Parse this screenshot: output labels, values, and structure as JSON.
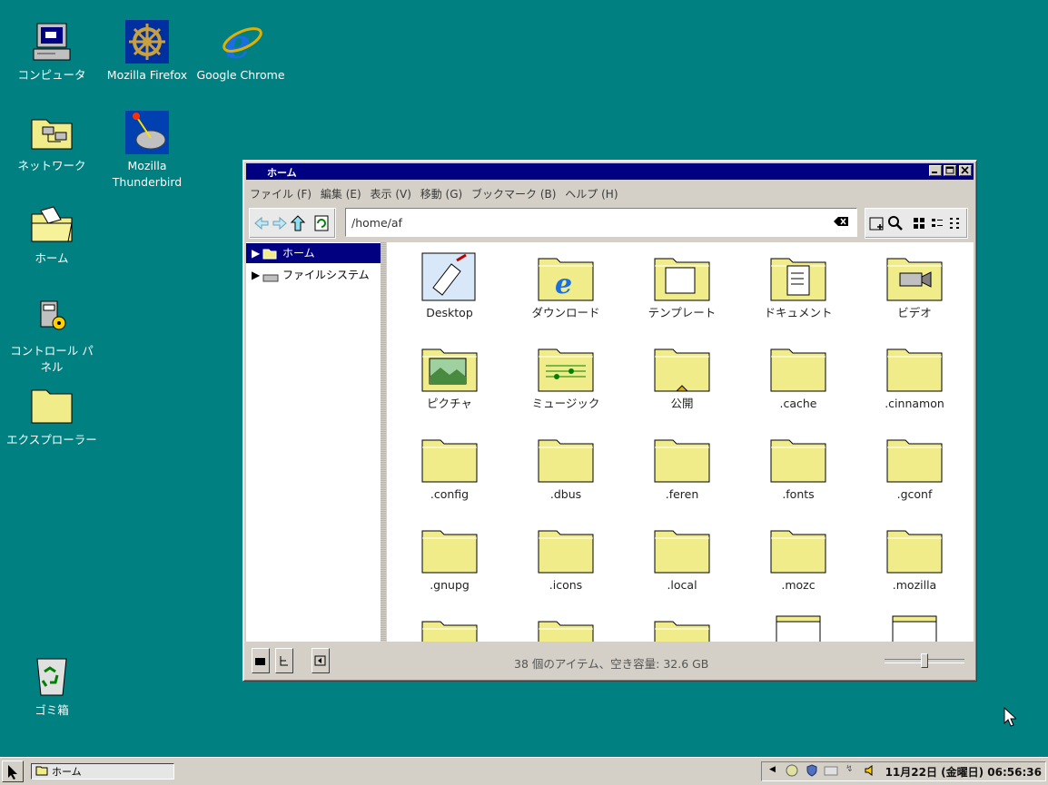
{
  "desktop": {
    "icons": [
      {
        "label": "コンピュータ",
        "icon": "computer-icon"
      },
      {
        "label": "Mozilla Firefox",
        "icon": "firefox-icon"
      },
      {
        "label": "Google Chrome",
        "icon": "chrome-icon"
      },
      {
        "label": "ネットワーク",
        "icon": "network-icon"
      },
      {
        "label": "Mozilla\nThunderbird",
        "icon": "thunderbird-icon"
      },
      {
        "label": "ホーム",
        "icon": "home-folder-icon"
      },
      {
        "label": "コントロール パネル",
        "icon": "control-panel-icon"
      },
      {
        "label": "エクスプローラー",
        "icon": "folder-icon"
      },
      {
        "label": "ゴミ箱",
        "icon": "trash-icon"
      }
    ]
  },
  "window": {
    "title": "ホーム",
    "menu": [
      "ファイル (F)",
      "編集 (E)",
      "表示 (V)",
      "移動 (G)",
      "ブックマーク (B)",
      "ヘルプ (H)"
    ],
    "address": "/home/af",
    "sidebar": [
      {
        "label": "ホーム",
        "icon": "home-icon",
        "selected": true
      },
      {
        "label": "ファイルシステム",
        "icon": "drive-icon",
        "selected": false
      }
    ],
    "files": [
      {
        "name": "Desktop",
        "icon": "desktop-icon"
      },
      {
        "name": "ダウンロード",
        "icon": "downloads-folder-icon"
      },
      {
        "name": "テンプレート",
        "icon": "templates-folder-icon"
      },
      {
        "name": "ドキュメント",
        "icon": "documents-folder-icon"
      },
      {
        "name": "ビデオ",
        "icon": "videos-folder-icon"
      },
      {
        "name": "ピクチャ",
        "icon": "pictures-folder-icon"
      },
      {
        "name": "ミュージック",
        "icon": "music-folder-icon"
      },
      {
        "name": "公開",
        "icon": "public-folder-icon"
      },
      {
        "name": ".cache",
        "icon": "folder-icon"
      },
      {
        "name": ".cinnamon",
        "icon": "folder-icon"
      },
      {
        "name": ".config",
        "icon": "folder-icon"
      },
      {
        "name": ".dbus",
        "icon": "folder-icon"
      },
      {
        "name": ".feren",
        "icon": "folder-icon"
      },
      {
        "name": ".fonts",
        "icon": "folder-icon"
      },
      {
        "name": ".gconf",
        "icon": "folder-icon"
      },
      {
        "name": ".gnupg",
        "icon": "folder-icon"
      },
      {
        "name": ".icons",
        "icon": "folder-icon"
      },
      {
        "name": ".local",
        "icon": "folder-icon"
      },
      {
        "name": ".mozc",
        "icon": "folder-icon"
      },
      {
        "name": ".mozilla",
        "icon": "folder-icon"
      }
    ],
    "status": "38 個のアイテム、空き容量: 32.6 GB",
    "zoom_level": 0.5
  },
  "taskbar": {
    "task_label": "ホーム",
    "clock": "11月22日 (金曜日) 06:56:36"
  },
  "colors": {
    "desktop": "#008080",
    "titlebar": "#000080",
    "folder": "#f0ec8a"
  }
}
